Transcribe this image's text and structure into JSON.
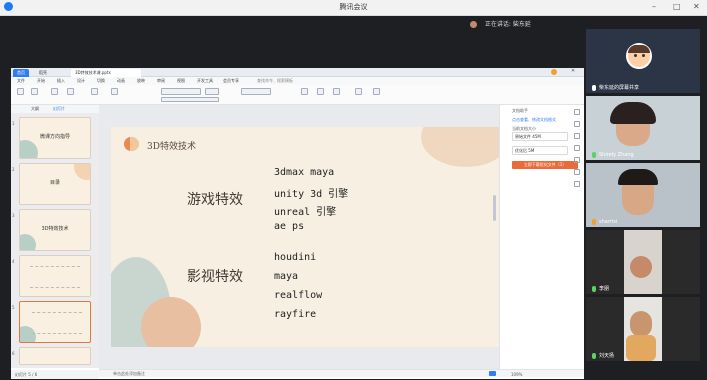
{
  "window": {
    "title": "腾讯会议"
  },
  "speaking": {
    "label": "正在讲话: 柴东延"
  },
  "wps": {
    "tabs": [
      "首页",
      "稻壳",
      "3D特效技术课.pptx"
    ],
    "menu": [
      "文件",
      "开始",
      "插入",
      "设计",
      "切换",
      "动画",
      "放映",
      "审阅",
      "视图",
      "开发工具",
      "会员专享",
      "查找命令、搜索模板"
    ],
    "thumb_tabs": [
      "大纲",
      "幻灯片"
    ],
    "thumbs": [
      {
        "num": "1",
        "title": "微课方向指导"
      },
      {
        "num": "2",
        "title": "目录"
      },
      {
        "num": "3",
        "title": "3D特效技术"
      },
      {
        "num": "4",
        "title": ""
      },
      {
        "num": "5",
        "title": ""
      },
      {
        "num": "6",
        "title": ""
      }
    ],
    "slide": {
      "title": "3D特效技术",
      "section1": "游戏特效",
      "section1_items": [
        "3dmax maya",
        "unity 3d 引擎",
        "unreal 引擎",
        "ae  ps"
      ],
      "section2": "影视特效",
      "section2_items": [
        "houdini",
        "maya",
        "realflow",
        "rayfire"
      ]
    },
    "notes_placeholder": "单击此处添加备注",
    "status_left": "幻灯片 5 / 6",
    "status_zoom": "109%",
    "right_panel": {
      "title": "文档助手",
      "link": "点击查看、修改文档格式",
      "label": "当前文档大小",
      "field1": "原始文件 45M",
      "field2": "优化后 5M",
      "button": "立即下载优化文件（1）"
    }
  },
  "participants": [
    {
      "name": "柴东延的屏幕共享"
    },
    {
      "name": "Shirely Zhang"
    },
    {
      "name": "sharrisi"
    },
    {
      "name": "李朋"
    },
    {
      "name": "刘天扬"
    }
  ]
}
